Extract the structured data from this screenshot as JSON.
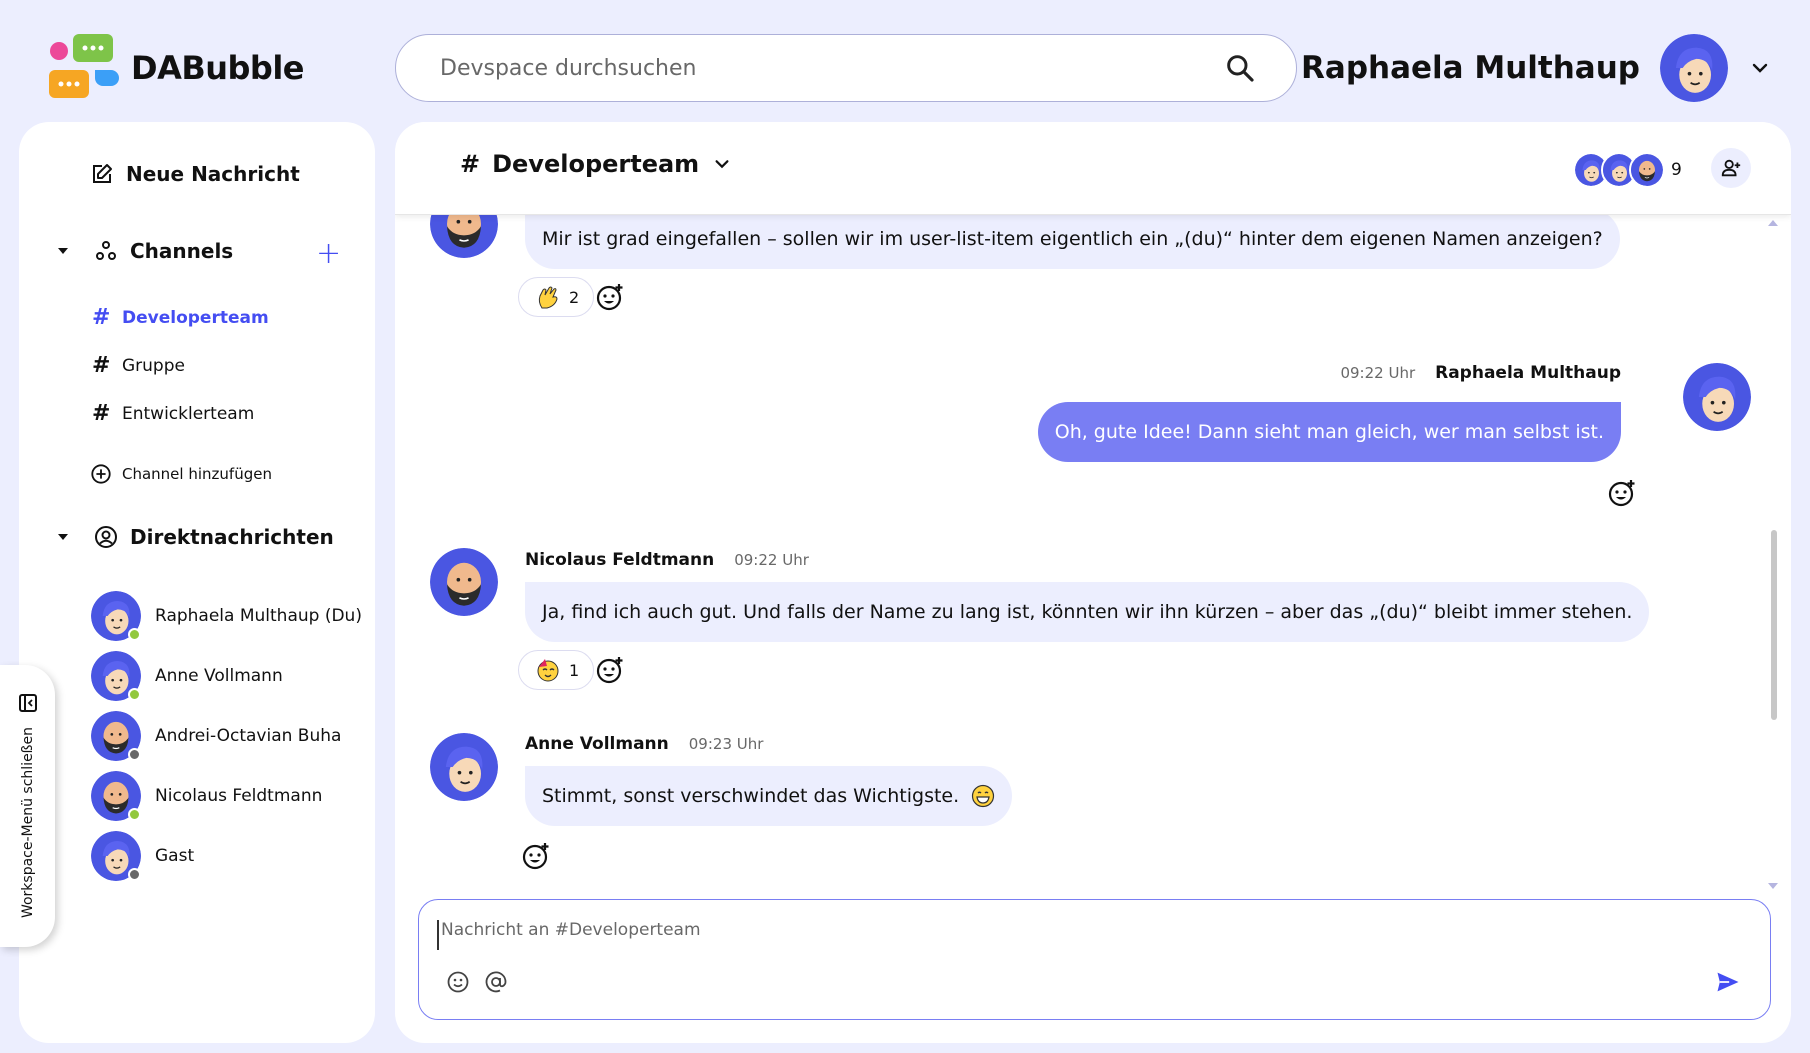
{
  "app": {
    "name": "DABubble"
  },
  "search": {
    "placeholder": "Devspace durchsuchen"
  },
  "current_user": {
    "name": "Raphaela Multhaup"
  },
  "sidebar": {
    "new_message_label": "Neue Nachricht",
    "channels_label": "Channels",
    "channels": [
      {
        "name": "Developerteam",
        "active": true
      },
      {
        "name": "Gruppe",
        "active": false
      },
      {
        "name": "Entwicklerteam",
        "active": false
      }
    ],
    "add_channel_label": "Channel hinzufügen",
    "dm_label": "Direktnachrichten",
    "direct_messages": [
      {
        "name": "Raphaela Multhaup (Du)",
        "status": "online",
        "avatar": "female-blue-hair"
      },
      {
        "name": "Anne Vollmann",
        "status": "online",
        "avatar": "female-blue-hair"
      },
      {
        "name": "Andrei-Octavian Buha",
        "status": "offline",
        "avatar": "male-bald-beard"
      },
      {
        "name": "Nicolaus Feldtmann",
        "status": "online",
        "avatar": "male-bald-beard"
      },
      {
        "name": "Gast",
        "status": "offline",
        "avatar": "female-blue-hair"
      }
    ],
    "collapse_label": "Workspace-Menü schließen"
  },
  "channel": {
    "name": "Developerteam",
    "member_count": "9"
  },
  "messages": [
    {
      "author": "",
      "time": "",
      "text": "Mir ist grad eingefallen – sollen wir im user-list-item eigentlich ein „(du)“ hinter dem eigenen Namen anzeigen?",
      "own": false,
      "reaction": {
        "emoji": "ok-hand-emoji",
        "count": "2"
      }
    },
    {
      "author": "Raphaela Multhaup",
      "time": "09:22 Uhr",
      "text": "Oh, gute Idee! Dann sieht man gleich, wer man selbst ist.",
      "own": true
    },
    {
      "author": "Nicolaus Feldtmann",
      "time": "09:22 Uhr",
      "text": "Ja, find ich auch gut. Und falls der Name zu lang ist, könnten wir ihn kürzen – aber das „(du)“ bleibt immer stehen.",
      "own": false,
      "reaction": {
        "emoji": "party-face-emoji",
        "count": "1"
      }
    },
    {
      "author": "Anne Vollmann",
      "time": "09:23 Uhr",
      "text": "Stimmt, sonst verschwindet das Wichtigste.",
      "own": false,
      "inline_emoji": "grin-emoji"
    }
  ],
  "composer": {
    "placeholder": "Nachricht an #Developerteam"
  },
  "colors": {
    "accent": "#444df2",
    "own_bubble": "#797ef3",
    "bubble": "#eceefe",
    "background": "#eceefe",
    "online": "#92c83e",
    "offline": "#686868"
  }
}
